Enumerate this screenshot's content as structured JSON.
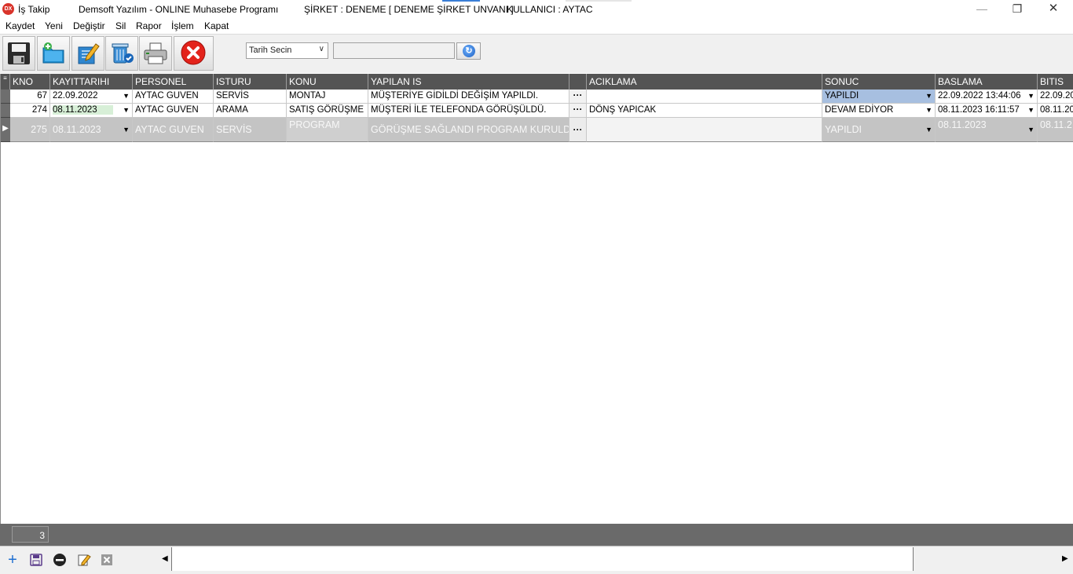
{
  "window": {
    "app_icon_text": "DX",
    "title": "İş Takip",
    "program": "Demsoft Yazılım - ONLINE Muhasebe Programı",
    "company": "ŞİRKET : DENEME [ DENEME ŞİRKET UNVANI ]",
    "user": "KULLANICI : AYTAC",
    "minimize": "—",
    "restore": "❐",
    "close": "✕"
  },
  "menu": [
    "Kaydet",
    "Yeni",
    "Değiştir",
    "Sil",
    "Rapor",
    "İşlem",
    "Kapat"
  ],
  "toolbar": {
    "buttons": [
      "save-icon",
      "new-folder-icon",
      "edit-icon",
      "delete-bin-icon",
      "printer-icon",
      "exit-icon"
    ],
    "date_select": "Tarih Secin",
    "filter_value": "",
    "refresh_icon": "refresh-icon"
  },
  "grid": {
    "columns": [
      "KNO",
      "KAYITTARIHI",
      "PERSONEL",
      "ISTURU",
      "KONU",
      "YAPILAN IS",
      "",
      "ACIKLAMA",
      "SONUC",
      "BASLAMA",
      "BITIS"
    ],
    "rows": [
      {
        "kno": "67",
        "kayit": "22.09.2022",
        "personel": "AYTAC GUVEN",
        "isturu": "SERVİS",
        "konu": "MONTAJ",
        "yapilan": "MÜŞTERİYE GİDİLDİ DEĞİŞİM YAPILDI.",
        "aciklama": "",
        "sonuc": "YAPILDI",
        "baslama": "22.09.2022 13:44:06",
        "bitis": "22.09.20"
      },
      {
        "kno": "274",
        "kayit": "08.11.2023",
        "personel": "AYTAC GUVEN",
        "isturu": "ARAMA",
        "konu": "SATIŞ GÖRÜŞME",
        "yapilan": "MÜŞTERİ İLE TELEFONDA GÖRÜŞÜLDÜ.",
        "aciklama": "DÖNŞ YAPICAK",
        "sonuc": "DEVAM EDİYOR",
        "baslama": "08.11.2023 16:11:57",
        "bitis": "08.11.20"
      },
      {
        "kno": "275",
        "kayit": "08.11.2023",
        "personel": "AYTAC GUVEN",
        "isturu": "SERVİS",
        "konu": "PROGRAM",
        "yapilan": "GÖRÜŞME SAĞLANDI PROGRAM KURULDU.",
        "aciklama": "",
        "sonuc": "YAPILDI",
        "baslama": "08.11.2023",
        "bitis": "08.11.2"
      }
    ],
    "ellipsis": "···",
    "current_row_marker": "▶"
  },
  "footer": {
    "record_count": "3"
  },
  "navigator": {
    "icons": [
      "add-icon",
      "save-icon",
      "remove-icon",
      "edit-icon",
      "cancel-icon"
    ]
  },
  "colors": {
    "header_bg": "#545454",
    "selected_cell": "#a7bfe0",
    "date_highlight": "#d7efd7",
    "editing_row": "#c4c4c4"
  }
}
